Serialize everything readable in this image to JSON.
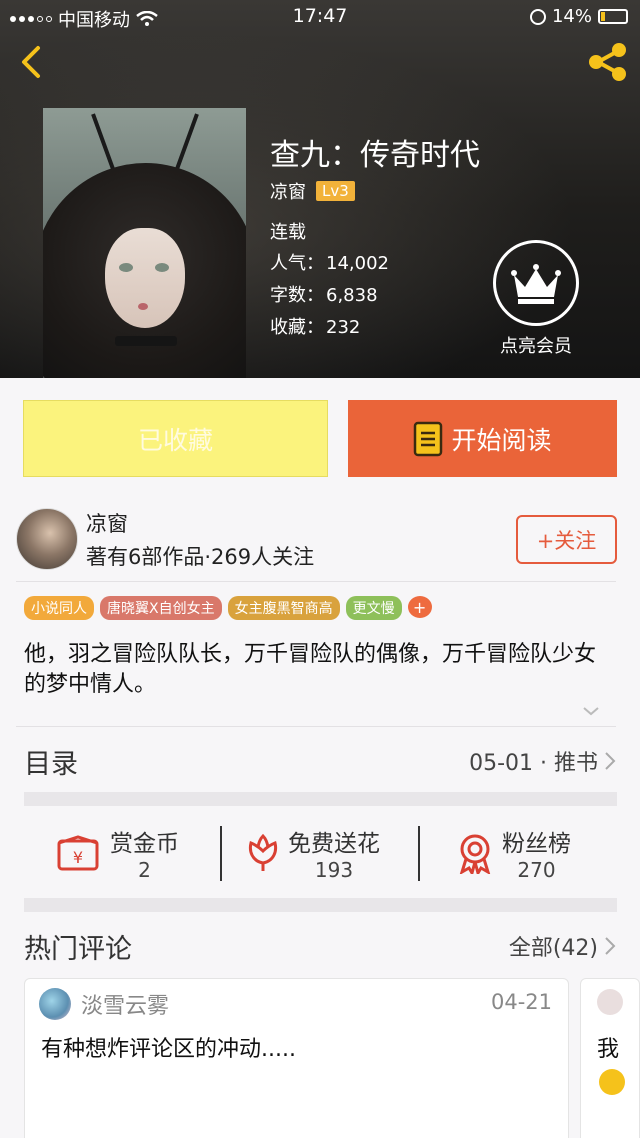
{
  "status_bar": {
    "carrier": "中国移动",
    "time": "17:47",
    "battery": "14%"
  },
  "book": {
    "title": "查九：传奇时代",
    "author": "凉窗",
    "level": "Lv3",
    "status": "连载",
    "popularity_label": "人气：",
    "popularity": "14,002",
    "words_label": "字数：",
    "words": "6,838",
    "favorites_label": "收藏：",
    "favorites": "232"
  },
  "vip": {
    "label": "点亮会员"
  },
  "actions": {
    "favorited_label": "已收藏",
    "read_label": "开始阅读"
  },
  "author_card": {
    "name": "凉窗",
    "stats": "著有6部作品·269人关注",
    "follow_label": "+关注"
  },
  "tags": [
    {
      "label": "小说同人",
      "color": "#f2a93b"
    },
    {
      "label": "唐晓翼X自创女主",
      "color": "#d9786a"
    },
    {
      "label": "女主腹黑智商高",
      "color": "#d9a23d"
    },
    {
      "label": "更文慢",
      "color": "#8ec05a"
    }
  ],
  "tag_more": "+",
  "intro": "他，羽之冒险队队长，万千冒险队的偶像，万千冒险队少女的梦中情人。",
  "catalog": {
    "title": "目录",
    "latest": "05-01 · 推书"
  },
  "stats": {
    "reward": {
      "label": "赏金币",
      "value": "2"
    },
    "flowers": {
      "label": "免费送花",
      "value": "193"
    },
    "fans": {
      "label": "粉丝榜",
      "value": "270"
    }
  },
  "comments_section": {
    "title": "热门评论",
    "all_label": "全部(42)"
  },
  "comments": [
    {
      "user": "淡雪云雾",
      "date": "04-21",
      "text": "有种想炸评论区的冲动....."
    },
    {
      "text": "我"
    }
  ],
  "colors": {
    "accent_orange": "#ea6439",
    "fav_yellow": "#fbf37d",
    "follow_red": "#e55b3d"
  }
}
